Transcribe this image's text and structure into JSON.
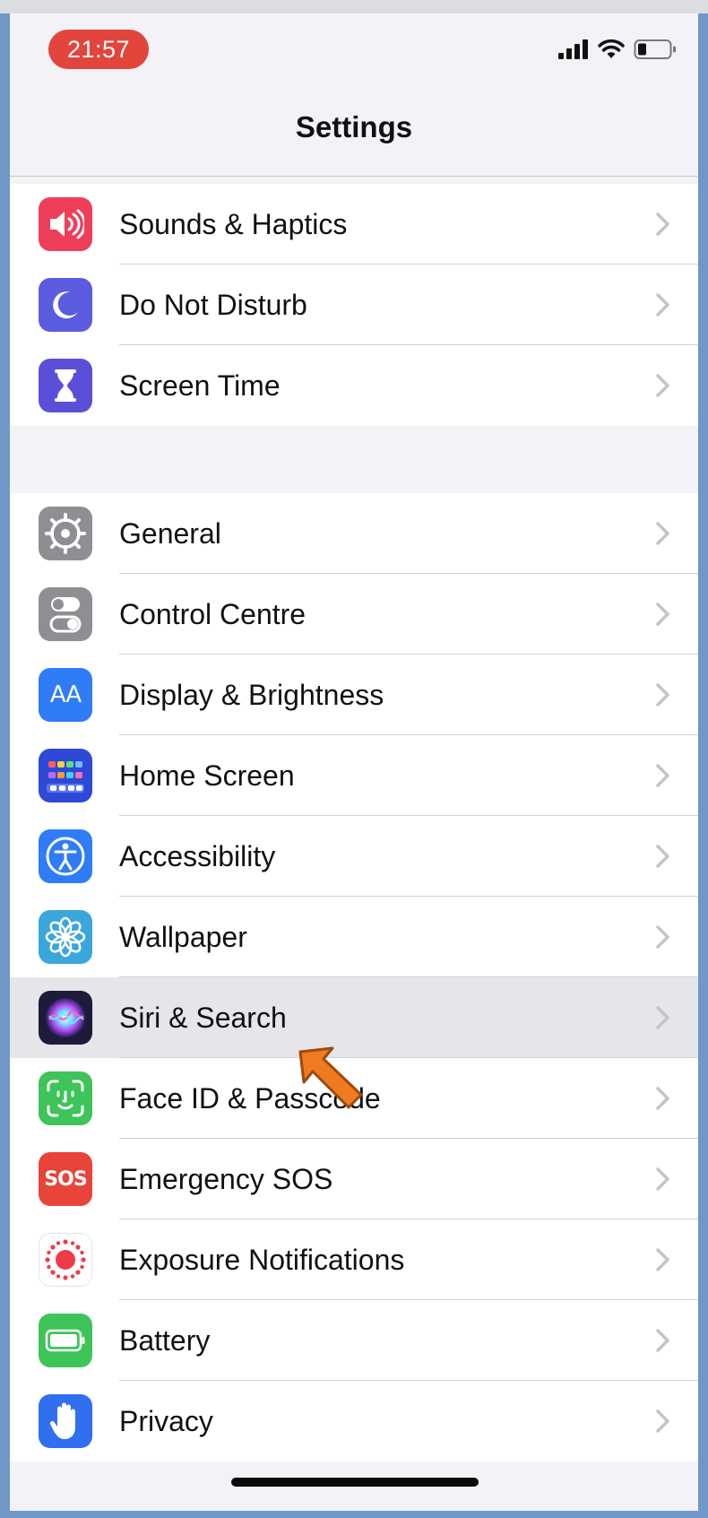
{
  "status_bar": {
    "time": "21:57"
  },
  "nav": {
    "title": "Settings"
  },
  "groups": [
    {
      "items": [
        {
          "label": "Sounds & Haptics",
          "icon": "speaker-icon",
          "color": "#ef3e5a"
        },
        {
          "label": "Do Not Disturb",
          "icon": "moon-icon",
          "color": "#5b5ce0"
        },
        {
          "label": "Screen Time",
          "icon": "hourglass-icon",
          "color": "#5b4fd8"
        }
      ]
    },
    {
      "items": [
        {
          "label": "General",
          "icon": "gear-icon",
          "color": "#8e8e93"
        },
        {
          "label": "Control Centre",
          "icon": "toggles-icon",
          "color": "#8e8e93"
        },
        {
          "label": "Display & Brightness",
          "icon": "text-size-icon",
          "color": "#2f7cf6",
          "glyph": "AA"
        },
        {
          "label": "Home Screen",
          "icon": "app-grid-icon",
          "color": "#2d49d6"
        },
        {
          "label": "Accessibility",
          "icon": "accessibility-icon",
          "color": "#2f7cf6"
        },
        {
          "label": "Wallpaper",
          "icon": "flower-icon",
          "color": "#3aa7dc"
        },
        {
          "label": "Siri & Search",
          "icon": "siri-icon",
          "color": "#1c1c3a",
          "highlighted": true
        },
        {
          "label": "Face ID & Passcode",
          "icon": "face-id-icon",
          "color": "#3ec459"
        },
        {
          "label": "Emergency SOS",
          "icon": "sos-icon",
          "color": "#e8443a",
          "glyph": "SOS"
        },
        {
          "label": "Exposure Notifications",
          "icon": "exposure-icon",
          "color": "#ffffff"
        },
        {
          "label": "Battery",
          "icon": "battery-icon",
          "color": "#3ec459"
        },
        {
          "label": "Privacy",
          "icon": "hand-icon",
          "color": "#2f6ff0"
        }
      ]
    }
  ]
}
